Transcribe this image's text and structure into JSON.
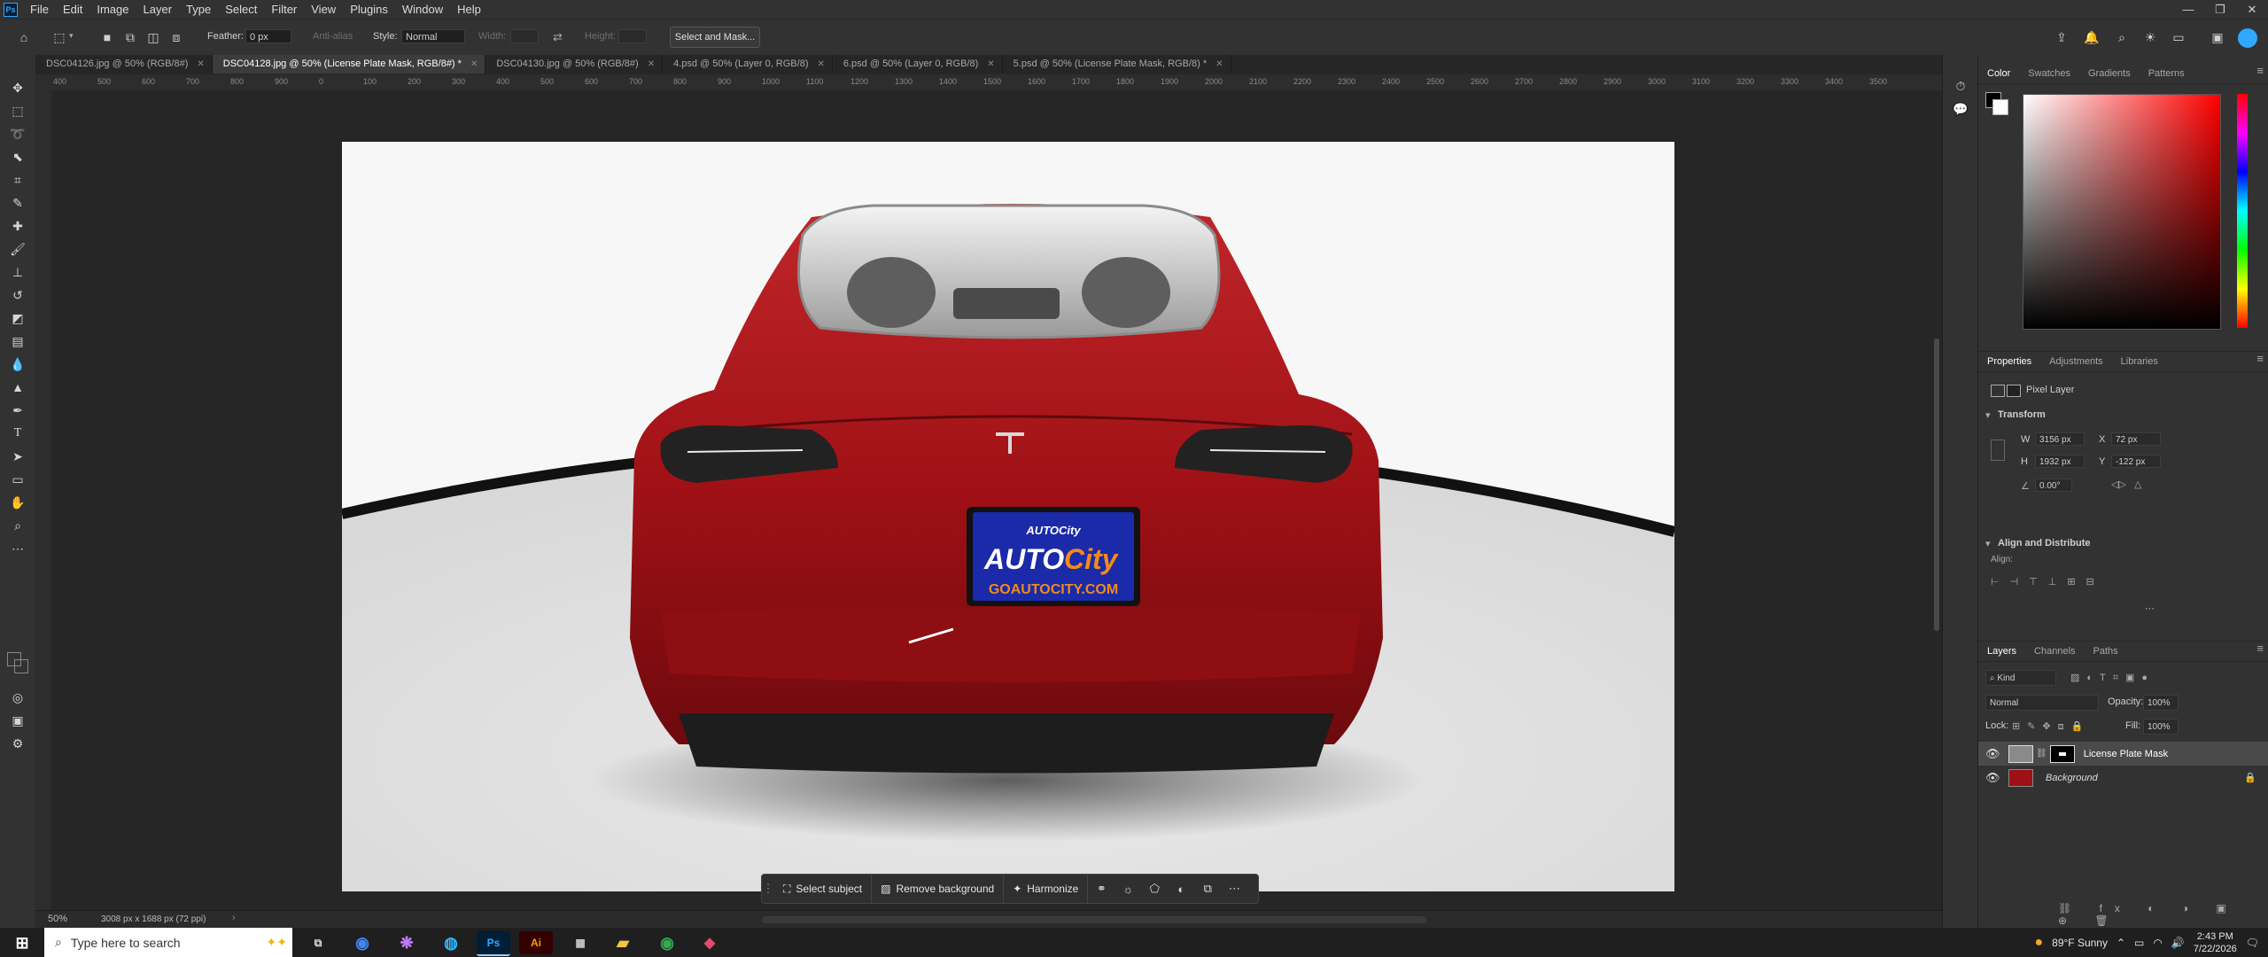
{
  "menu": {
    "app_icon": "Ps",
    "items": [
      "File",
      "Edit",
      "Image",
      "Layer",
      "Type",
      "Select",
      "Filter",
      "View",
      "Plugins",
      "Window",
      "Help"
    ]
  },
  "options": {
    "feather_label": "Feather:",
    "feather_value": "0 px",
    "antialias_label": "Anti-alias",
    "style_label": "Style:",
    "style_value": "Normal",
    "width_label": "Width:",
    "height_label": "Height:",
    "select_mask_label": "Select and Mask..."
  },
  "tabs": [
    {
      "label": "DSC04126.jpg @ 50% (RGB/8#)",
      "active": false
    },
    {
      "label": "DSC04128.jpg @ 50% (License Plate Mask, RGB/8#) *",
      "active": true
    },
    {
      "label": "DSC04130.jpg @ 50% (RGB/8#)",
      "active": false
    },
    {
      "label": "4.psd @ 50% (Layer 0, RGB/8)",
      "active": false
    },
    {
      "label": "6.psd @ 50% (Layer 0, RGB/8)",
      "active": false
    },
    {
      "label": "5.psd @ 50% (License Plate Mask, RGB/8) *",
      "active": false
    }
  ],
  "ruler": {
    "ticks": [
      "400",
      "500",
      "600",
      "700",
      "800",
      "900",
      "0",
      "100",
      "200",
      "300",
      "400",
      "500",
      "600",
      "700",
      "800",
      "900",
      "1000",
      "1100",
      "1200",
      "1300",
      "1400",
      "1500",
      "1600",
      "1700",
      "1800",
      "1900",
      "2000",
      "2100",
      "2200",
      "2300",
      "2400",
      "2500",
      "2600",
      "2700",
      "2800",
      "2900",
      "3000",
      "3100",
      "3200",
      "3300",
      "3400",
      "3500"
    ]
  },
  "plate": {
    "brand_small": "AUTOCity",
    "brand_auto": "AUTO",
    "brand_city": "City",
    "url": "GOAUTOCITY.COM"
  },
  "context_bar": {
    "select_subject": "Select subject",
    "remove_background": "Remove background",
    "harmonize": "Harmonize"
  },
  "status": {
    "zoom": "50%",
    "doc_info": "3008 px x 1688 px (72 ppi)"
  },
  "panels": {
    "color_tabs": [
      "Color",
      "Swatches",
      "Gradients",
      "Patterns"
    ],
    "properties_tabs": [
      "Properties",
      "Adjustments",
      "Libraries"
    ],
    "pixel_layer": "Pixel Layer",
    "transform_label": "Transform",
    "w_label": "W",
    "w_value": "3156 px",
    "h_label": "H",
    "h_value": "1932 px",
    "x_label": "X",
    "x_value": "72 px",
    "y_label": "Y",
    "y_value": "-122 px",
    "angle_value": "0.00°",
    "align_label": "Align and Distribute",
    "align_sub": "Align:",
    "layers_tabs": [
      "Layers",
      "Channels",
      "Paths"
    ],
    "kind_label": "Kind",
    "blend_mode": "Normal",
    "opacity_label": "Opacity:",
    "opacity_value": "100%",
    "lock_label": "Lock:",
    "fill_label": "Fill:",
    "fill_value": "100%",
    "layers": [
      {
        "name": "License Plate Mask",
        "selected": true
      },
      {
        "name": "Background",
        "selected": false
      }
    ],
    "foreground_color": "#000000",
    "background_color": "#ffffff",
    "picker_hue": "#ff0000"
  },
  "windows_taskbar": {
    "search_placeholder": "Type here to search",
    "weather": "89°F  Sunny",
    "time": "2:43 PM",
    "date": "7/22/2026",
    "apps": [
      "chrome-icon",
      "copilot-icon",
      "edge-icon",
      "photoshop-icon",
      "illustrator-icon",
      "calculator-icon",
      "file-explorer-icon",
      "chrome-profile-icon",
      "app-icon"
    ]
  }
}
